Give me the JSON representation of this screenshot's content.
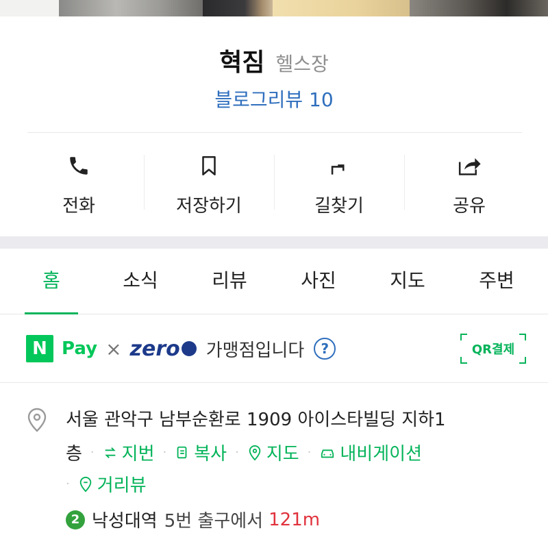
{
  "place": {
    "name": "혁짐",
    "category": "헬스장",
    "blog_review": "블로그리뷰 10"
  },
  "actions": [
    {
      "label": "전화",
      "icon": "phone-icon"
    },
    {
      "label": "저장하기",
      "icon": "bookmark-icon"
    },
    {
      "label": "길찾기",
      "icon": "directions-icon"
    },
    {
      "label": "공유",
      "icon": "share-icon"
    }
  ],
  "tabs": [
    {
      "label": "홈",
      "active": true
    },
    {
      "label": "소식"
    },
    {
      "label": "리뷰"
    },
    {
      "label": "사진"
    },
    {
      "label": "지도"
    },
    {
      "label": "주변"
    }
  ],
  "pay": {
    "npay_mark": "N",
    "npay_text": "Pay",
    "cross": "×",
    "zero_text": "zero",
    "merchant_text": "가맹점입니다",
    "help": "?",
    "qr_label": "QR결제"
  },
  "address": {
    "line1": "서울 관악구 남부순환로 1909 아이스타빌딩 지하1",
    "floor": "층",
    "chips": {
      "lot": "지번",
      "copy": "복사",
      "map": "지도",
      "navigation": "내비게이션",
      "street_view": "거리뷰"
    },
    "separator": "·"
  },
  "station": {
    "line_number": "2",
    "name": "낙성대역",
    "exit": "5번 출구에서",
    "distance": "121m"
  },
  "colors": {
    "accent_green": "#03b359",
    "link_blue": "#2e6ebd",
    "distance_red": "#e0323c",
    "line2_green": "#33a23d"
  }
}
